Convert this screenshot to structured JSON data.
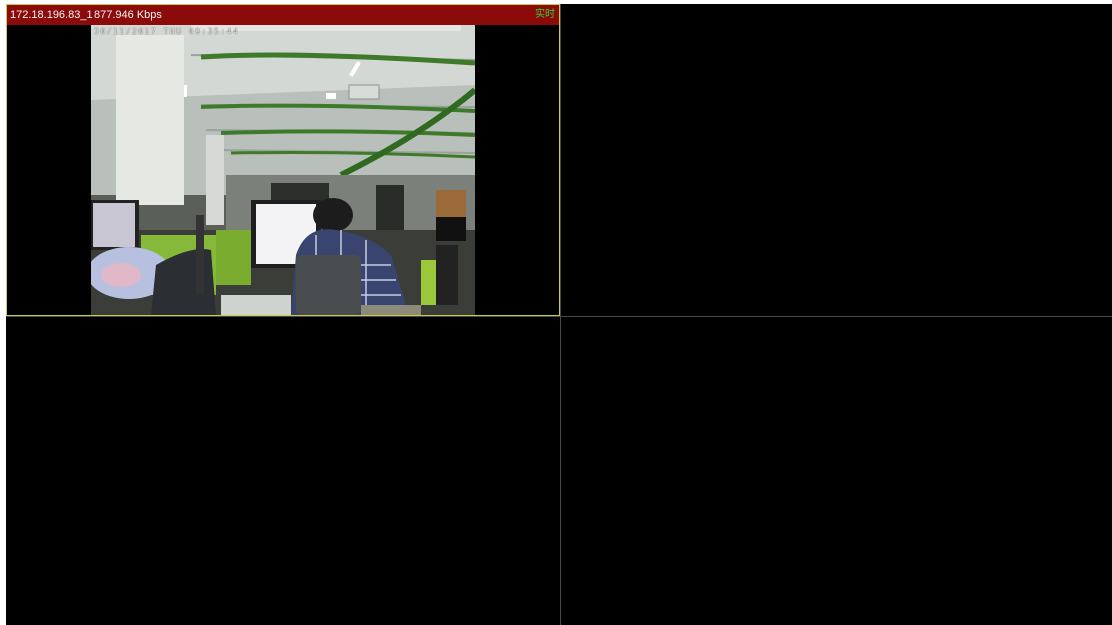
{
  "panes": [
    {
      "camera_name": "172.18.196.83_1",
      "bitrate": "877.946 Kbps",
      "status": "实时",
      "osd_timestamp": "30/11/2017 THU 09:35:44",
      "active": true
    },
    {
      "active": false
    },
    {
      "active": false
    },
    {
      "active": false
    }
  ],
  "colors": {
    "titlebar": "#8b0b0b",
    "status_text": "#38d038",
    "active_border": "#c9c94a",
    "background": "#000000"
  }
}
